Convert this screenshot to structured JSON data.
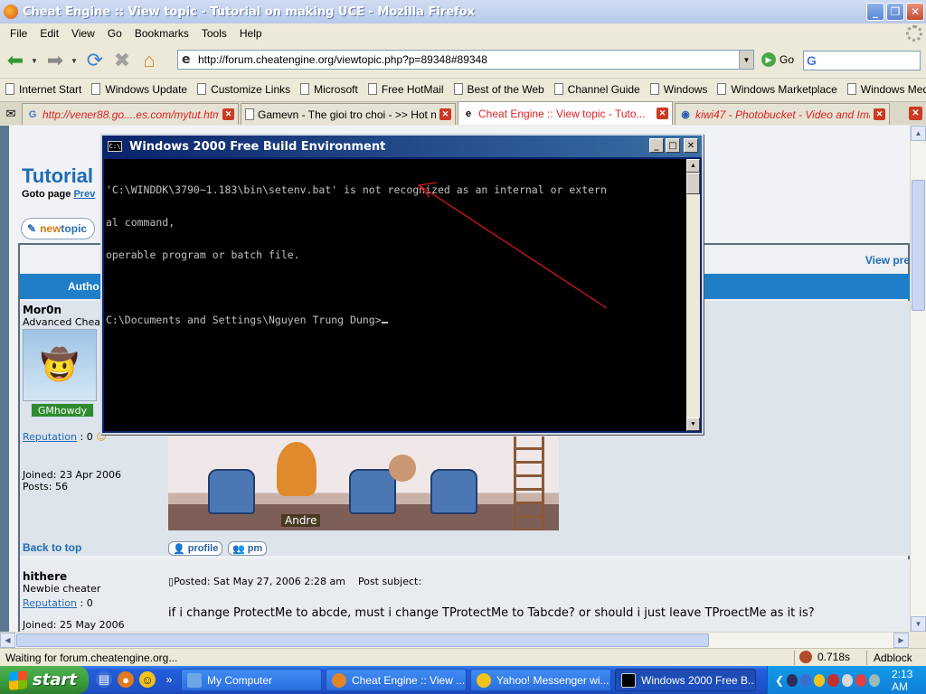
{
  "browser": {
    "title": "Cheat Engine :: View topic - Tutorial on making UCE - Mozilla Firefox",
    "menu": [
      "File",
      "Edit",
      "View",
      "Go",
      "Bookmarks",
      "Tools",
      "Help"
    ],
    "url": "http://forum.cheatengine.org/viewtopic.php?p=89348#89348",
    "go_label": "Go",
    "search_placeholder": "",
    "bookmarks": [
      "Internet Start",
      "Windows Update",
      "Customize Links",
      "Microsoft",
      "Free HotMail",
      "Best of the Web",
      "Channel Guide",
      "Windows",
      "Windows Marketplace",
      "Windows Media"
    ],
    "tabs": [
      {
        "label": "http://vener88.go....es.com/mytut.html",
        "style": "red"
      },
      {
        "label": "Gamevn - The gioi tro choi - >> Hot n...",
        "style": "normal"
      },
      {
        "label": "Cheat Engine :: View topic - Tuto...",
        "style": "active"
      },
      {
        "label": "kiwi47 - Photobucket - Video and Ima...",
        "style": "red"
      }
    ],
    "status": "Waiting for forum.cheatengine.org...",
    "timing": "0.718s",
    "adblock": "Adblock"
  },
  "forum": {
    "title": "Tutorial",
    "goto_label": "Goto page",
    "goto_link": "Prev",
    "newtopic_prefix": "new",
    "newtopic_suffix": "topic",
    "view_prev": "View pre",
    "author_header": "Autho",
    "trailing_dots": "..",
    "post1": {
      "username": "Mor0n",
      "rank": "Advanced Chea",
      "badge": "GMhowdy",
      "rep_label": "Reputation",
      "rep_value": ": 0",
      "joined": "Joined: 23 Apr 2006",
      "posts": "Posts: 56",
      "image_caption": "Andre",
      "back_to_top": "Back to top",
      "profile_btn": "profile",
      "pm_btn": "pm"
    },
    "post2": {
      "username": "hithere",
      "rank": "Newbie cheater",
      "rep_label": "Reputation",
      "rep_value": ": 0",
      "joined": "Joined: 25 May 2006",
      "posted": "Posted: Sat May 27, 2006 2:28 am",
      "subject": "Post subject:",
      "body": "if i change ProtectMe to abcde, must i change TProtectMe to Tabcde? or should i just leave TProectMe as it is?"
    }
  },
  "cmd": {
    "title": "Windows 2000 Free Build Environment",
    "icon_label": "C:\\",
    "lines": [
      "'C:\\WINDDK\\3790~1.183\\bin\\setenv.bat' is not recognized as an internal or extern",
      "al command,",
      "operable program or batch file.",
      "",
      "C:\\Documents and Settings\\Nguyen Trung Dung>"
    ]
  },
  "taskbar": {
    "start": "start",
    "tasks": [
      {
        "label": "My Computer"
      },
      {
        "label": "Cheat Engine :: View ..."
      },
      {
        "label": "Yahoo! Messenger wi..."
      },
      {
        "label": "Windows 2000 Free B..."
      }
    ],
    "clock": "2:13 AM"
  },
  "colors": {
    "link": "#1f6bb4",
    "author_bar": "#1e7fc8",
    "annotation_arrow": "#d01818"
  }
}
